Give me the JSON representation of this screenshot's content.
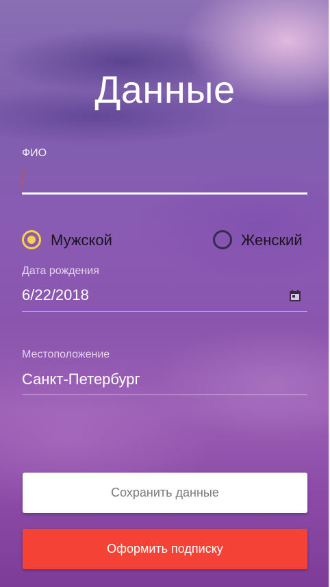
{
  "page": {
    "title": "Данные"
  },
  "fio": {
    "label": "ФИО",
    "value": ""
  },
  "gender": {
    "options": [
      {
        "label": "Мужской",
        "selected": true
      },
      {
        "label": "Женский",
        "selected": false
      }
    ]
  },
  "birth_date": {
    "label": "Дата рождения",
    "value": "6/22/2018",
    "icon": "calendar-icon"
  },
  "location": {
    "label": "Местоположение",
    "value": "Санкт-Петербург"
  },
  "buttons": {
    "save_label": "Сохранить данные",
    "subscribe_label": "Оформить подписку"
  },
  "colors": {
    "radio_selected": "#f9d23c",
    "subscribe_button": "#f44336",
    "cursor": "#e14a2a"
  }
}
